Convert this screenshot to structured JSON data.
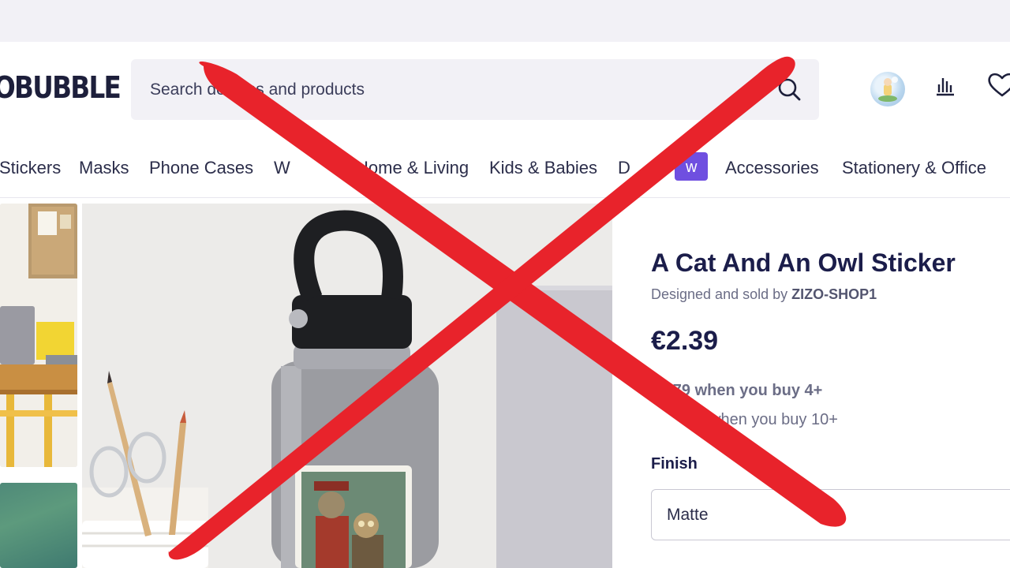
{
  "header": {
    "logo_text": "OBUBBLE",
    "search": {
      "placeholder": "Search designs and products"
    },
    "icons": [
      "search-icon",
      "avatar",
      "bar-chart-icon",
      "heart-icon"
    ]
  },
  "nav": {
    "items": [
      {
        "label": "Stickers"
      },
      {
        "label": "Masks"
      },
      {
        "label": "Phone Cases"
      },
      {
        "label": "W"
      },
      {
        "label": "Home & Living"
      },
      {
        "label": "Kids & Babies"
      },
      {
        "label": "D"
      },
      {
        "label": "Accessories"
      },
      {
        "label": "Stationery & Office"
      }
    ],
    "badge_text": "w",
    "badge_color": "#6f4fe0"
  },
  "product": {
    "title": "A Cat And An Owl Sticker",
    "byline_prefix": "Designed and sold by",
    "seller": "ZIZO-SHOP1",
    "price": "€2.39",
    "bulk_1": "€1.79 when you buy 4+",
    "bulk_2": "when you buy 10+",
    "finish_label": "Finish",
    "finish_value": "Matte"
  },
  "overlay": {
    "cross_color": "#e8232b"
  }
}
